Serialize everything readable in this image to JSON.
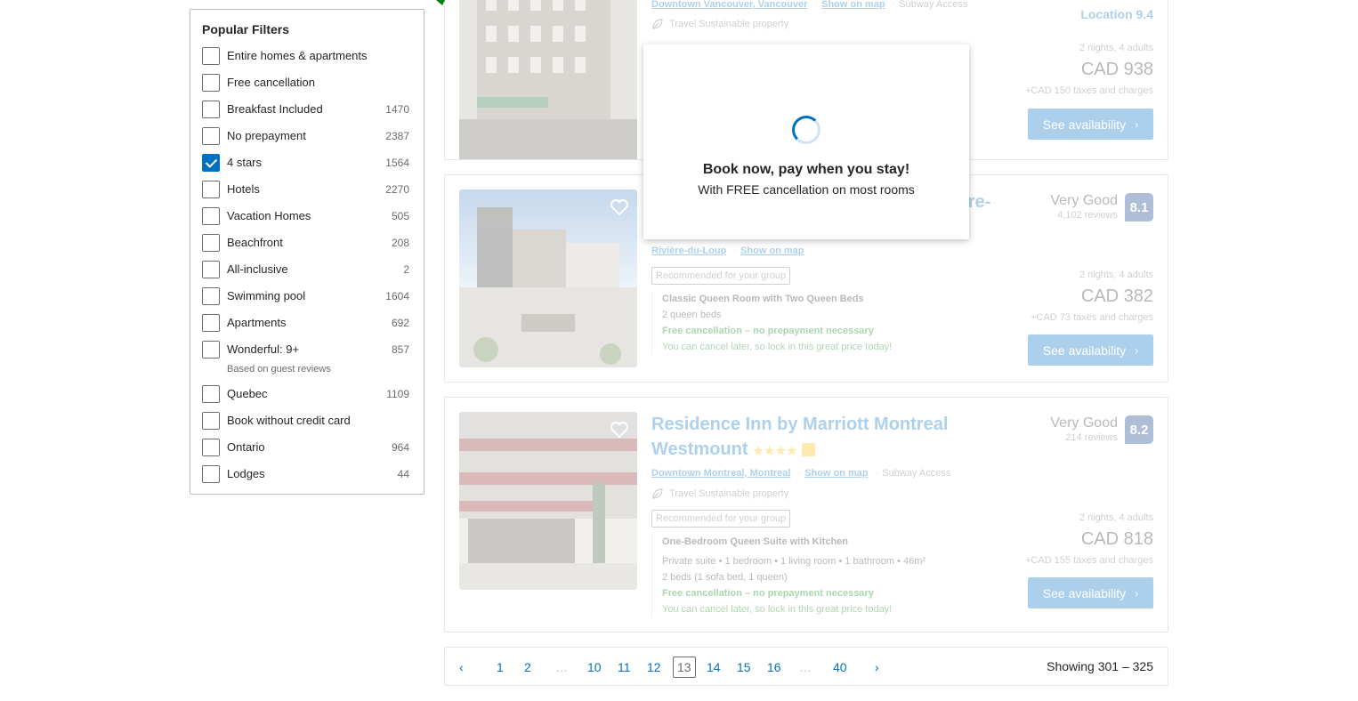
{
  "filters": {
    "title": "Popular Filters",
    "items": [
      {
        "label": "Entire homes & apartments",
        "count": "",
        "checked": false
      },
      {
        "label": "Free cancellation",
        "count": "",
        "checked": false
      },
      {
        "label": "Breakfast Included",
        "count": "1470",
        "checked": false
      },
      {
        "label": "No prepayment",
        "count": "2387",
        "checked": false
      },
      {
        "label": "4 stars",
        "count": "1564",
        "checked": true
      },
      {
        "label": "Hotels",
        "count": "2270",
        "checked": false
      },
      {
        "label": "Vacation Homes",
        "count": "505",
        "checked": false
      },
      {
        "label": "Beachfront",
        "count": "208",
        "checked": false
      },
      {
        "label": "All-inclusive",
        "count": "2",
        "checked": false
      },
      {
        "label": "Swimming pool",
        "count": "1604",
        "checked": false
      },
      {
        "label": "Apartments",
        "count": "692",
        "checked": false
      },
      {
        "label": "Wonderful: 9+",
        "count": "857",
        "checked": false,
        "sub": "Based on guest reviews"
      },
      {
        "label": "Quebec",
        "count": "1109",
        "checked": false
      },
      {
        "label": "Book without credit card",
        "count": "",
        "checked": false
      },
      {
        "label": "Ontario",
        "count": "964",
        "checked": false
      },
      {
        "label": "Lodges",
        "count": "44",
        "checked": false
      }
    ]
  },
  "card1": {
    "location": "Downtown Vancouver, Vancouver",
    "show_map": "Show on map",
    "subway": "Subway Access",
    "sustainable": "Travel Sustainable property",
    "location_score": "Location 9.4",
    "nights": "2 nights, 4 adults",
    "price": "CAD 938",
    "taxes": "+CAD 150 taxes and charges",
    "button": "See availability"
  },
  "card2": {
    "title_fragment": "vière-",
    "review_word": "Very Good",
    "review_count": "4,102 reviews",
    "score": "8.1",
    "location": "Rivière-du-Loup",
    "show_map": "Show on map",
    "group": "Recommended for your group",
    "room_name": "Classic Queen Room with Two Queen Beds",
    "beds": "2 queen beds",
    "free_cancel": "Free cancellation – no prepayment necessary",
    "cancel_note": "You can cancel later, so lock in this great price today!",
    "nights": "2 nights, 4 adults",
    "price": "CAD 382",
    "taxes": "+CAD 73 taxes and charges",
    "button": "See availability"
  },
  "card3": {
    "title_line1": "Residence Inn by Marriott Montreal",
    "title_line2": "Westmount",
    "stars": "★★★★",
    "review_word": "Very Good",
    "review_count": "214 reviews",
    "score": "8.2",
    "location": "Downtown Montreal, Montreal",
    "show_map": "Show on map",
    "subway": "Subway Access",
    "sustainable": "Travel Sustainable property",
    "group": "Recommended for your group",
    "room_name": "One-Bedroom Queen Suite with Kitchen",
    "details": "Private suite • 1 bedroom • 1 living room • 1 bathroom • 46m²",
    "beds": "2 beds (1 sofa bed, 1 queen)",
    "free_cancel": "Free cancellation – no prepayment necessary",
    "cancel_note": "You can cancel later, so lock in this great price today!",
    "nights": "2 nights, 4 adults",
    "price": "CAD 818",
    "taxes": "+CAD 155 taxes and charges",
    "button": "See availability"
  },
  "pagination": {
    "prev": "‹",
    "next": "›",
    "ellipsis": "…",
    "pages": [
      "1",
      "2",
      "10",
      "11",
      "12",
      "13",
      "14",
      "15",
      "16",
      "40"
    ],
    "current": "13",
    "showing": "Showing 301 – 325"
  },
  "modal": {
    "heading": "Book now, pay when you stay!",
    "subtext": "With FREE cancellation on most rooms"
  },
  "colors": {
    "brand_blue": "#0071c2",
    "score_navy": "#003580",
    "green": "#008009",
    "star_yellow": "#febb02"
  }
}
